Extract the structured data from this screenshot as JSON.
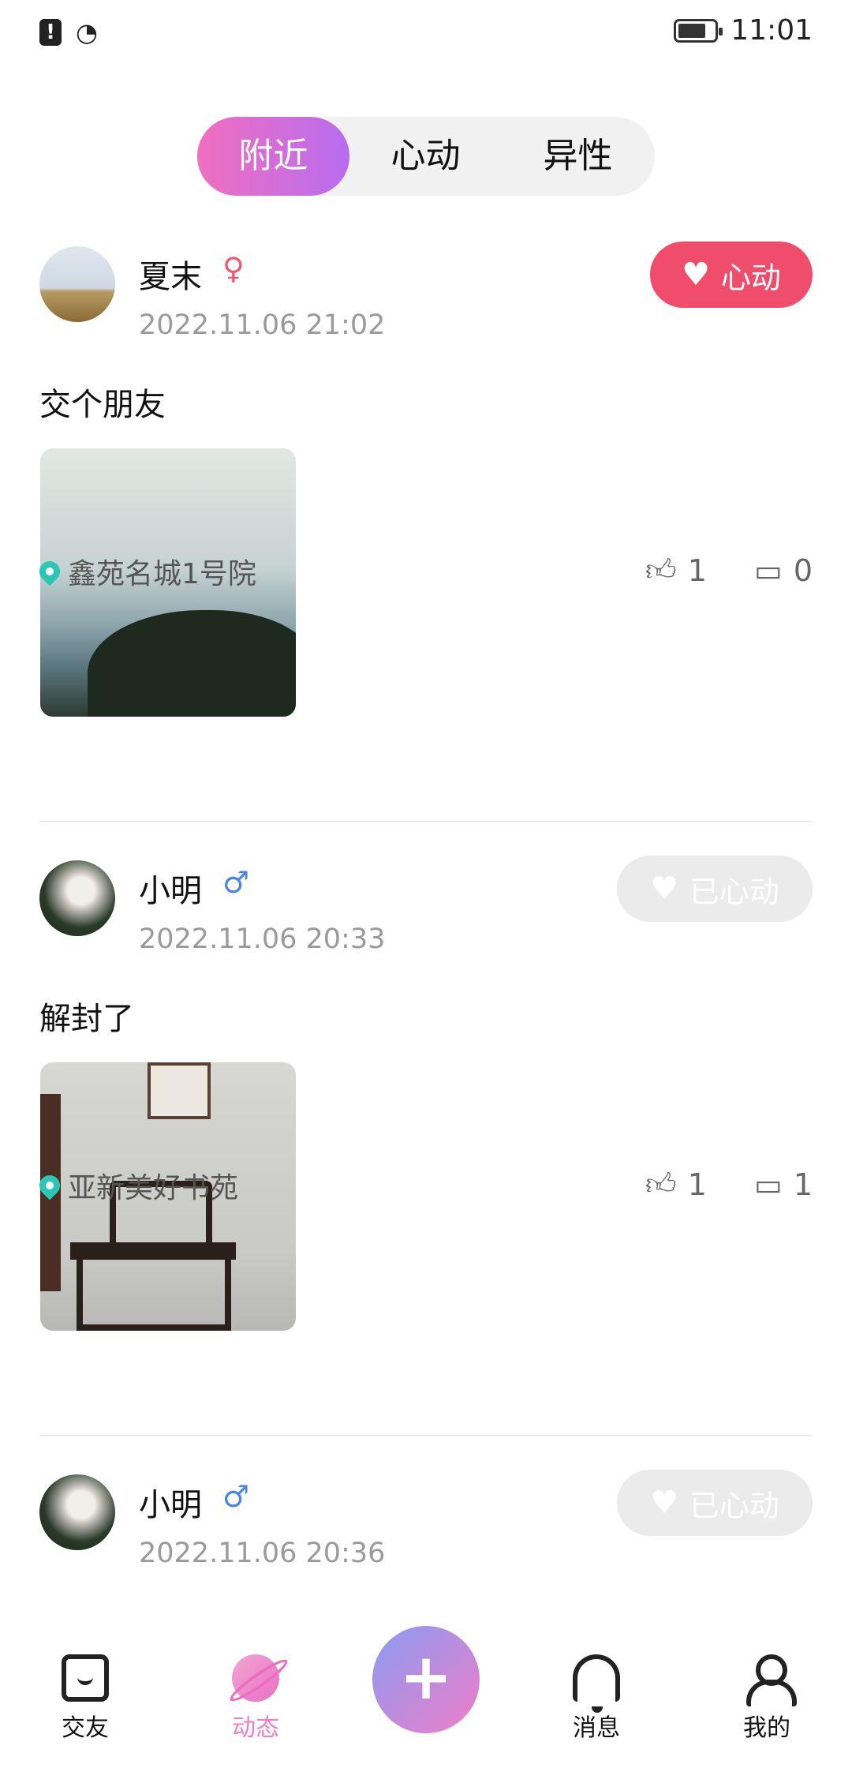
{
  "status_bar": {
    "time": "11:01"
  },
  "tabs": [
    {
      "label": "附近",
      "active": true
    },
    {
      "label": "心动",
      "active": false
    },
    {
      "label": "异性",
      "active": false
    }
  ],
  "posts": [
    {
      "user": "夏末",
      "gender": "female",
      "gender_symbol": "♀",
      "time": "2022.11.06 21:02",
      "like_button": "心动",
      "liked": false,
      "text": "交个朋友",
      "location": "鑫苑名城1号院",
      "likes": "1",
      "comments": "0"
    },
    {
      "user": "小明",
      "gender": "male",
      "gender_symbol": "♂",
      "time": "2022.11.06 20:33",
      "like_button": "已心动",
      "liked": true,
      "text": "解封了",
      "location": "亚新美好书苑",
      "likes": "1",
      "comments": "1"
    },
    {
      "user": "小明",
      "gender": "male",
      "gender_symbol": "♂",
      "time": "2022.11.06 20:36",
      "like_button": "已心动",
      "liked": true
    }
  ],
  "bottom_nav": [
    {
      "label": "交友",
      "icon": "chat-icon",
      "active": false
    },
    {
      "label": "动态",
      "icon": "planet-icon",
      "active": true
    },
    {
      "label": "消息",
      "icon": "bell-icon",
      "active": false
    },
    {
      "label": "我的",
      "icon": "user-icon",
      "active": false
    }
  ],
  "fab": {
    "icon": "plus-icon",
    "symbol": "+"
  },
  "colors": {
    "accent_pink": "#f04d6c",
    "tab_gradient_start": "#f06fbf",
    "tab_gradient_end": "#b86cf0",
    "active_nav": "#f07dc8",
    "location_pin": "#2bc7b5"
  }
}
